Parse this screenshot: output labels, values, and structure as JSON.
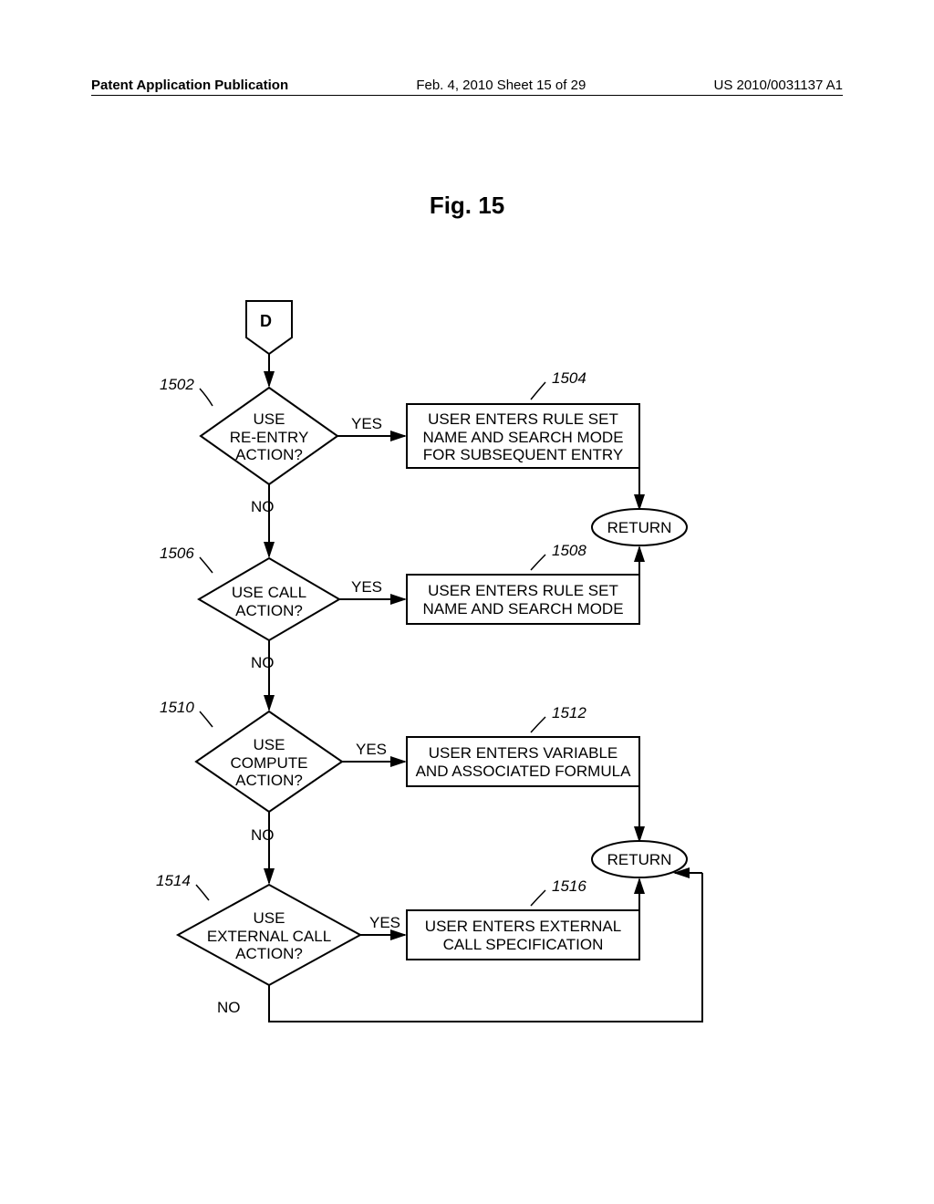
{
  "header": {
    "left": "Patent Application Publication",
    "center": "Feb. 4, 2010  Sheet 15 of 29",
    "right": "US 2010/0031137 A1"
  },
  "figure_title": "Fig. 15",
  "connector_label": "D",
  "refs": {
    "r1502": "1502",
    "r1504": "1504",
    "r1506": "1506",
    "r1508": "1508",
    "r1510": "1510",
    "r1512": "1512",
    "r1514": "1514",
    "r1516": "1516"
  },
  "decisions": {
    "d1": "USE\nRE-ENTRY\nACTION?",
    "d2": "USE CALL\nACTION?",
    "d3": "USE\nCOMPUTE\nACTION?",
    "d4": "USE\nEXTERNAL CALL\nACTION?"
  },
  "processes": {
    "p1": "USER ENTERS  RULE SET\nNAME AND SEARCH MODE\nFOR SUBSEQUENT ENTRY",
    "p2": "USER ENTERS  RULE SET\nNAME  AND SEARCH MODE",
    "p3": "USER ENTERS VARIABLE\nAND ASSOCIATED FORMULA",
    "p4": "USER ENTERS EXTERNAL\nCALL SPECIFICATION"
  },
  "terminals": {
    "t1": "RETURN",
    "t2": "RETURN"
  },
  "branches": {
    "yes": "YES",
    "no": "NO"
  }
}
